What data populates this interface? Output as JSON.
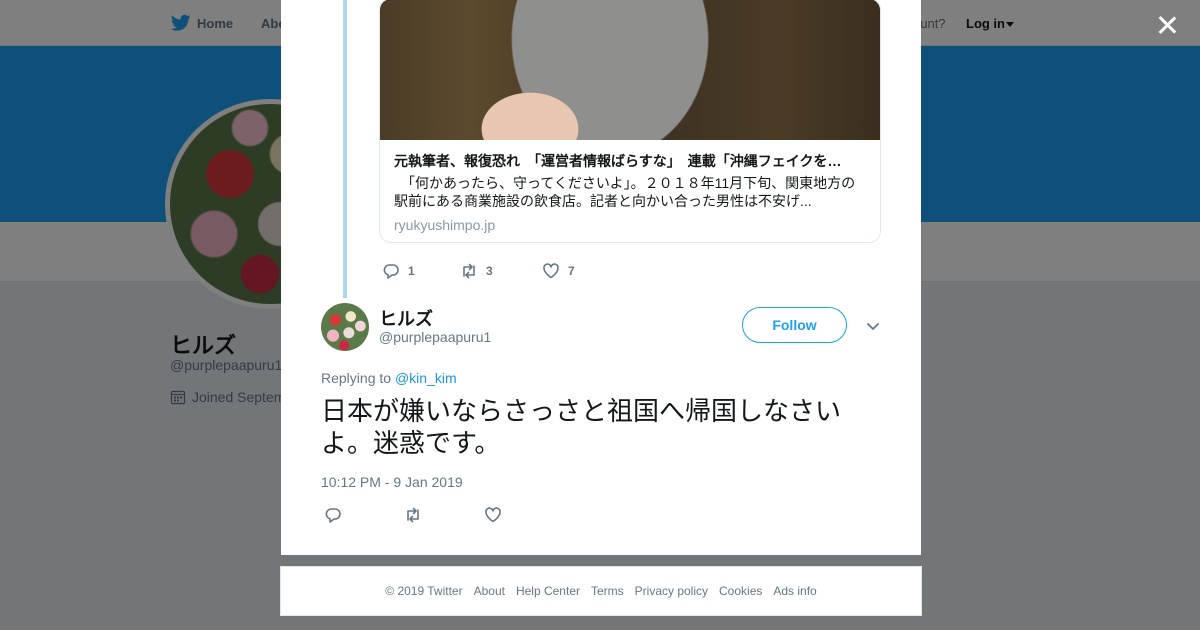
{
  "topbar": {
    "home_label": "Home",
    "about_label": "Abo",
    "account_prompt": "ccount?",
    "login_label": "Log in"
  },
  "profile": {
    "name": "ヒルズ",
    "handle": "@purplepaapuru1",
    "joined": "Joined Septem"
  },
  "link_card": {
    "title": "元執筆者、報復恐れ　「運営者情報ばらすな」　連載「沖縄フェイクを…",
    "description": "　「何かあったら、守ってくださいよ」。２０１８年11月下旬、関東地方の駅前にある商業施設の飲食店。記者と向かい合った男性は不安げ...",
    "domain": "ryukyushimpo.jp"
  },
  "parent_actions": {
    "replies": "1",
    "retweets": "3",
    "likes": "7"
  },
  "tweet": {
    "author_name": "ヒルズ",
    "author_handle": "@purplepaapuru1",
    "follow_label": "Follow",
    "replying_prefix": "Replying to ",
    "replying_to": "@kin_kim",
    "text": "日本が嫌いならさっさと祖国へ帰国しなさいよ。迷惑です。",
    "timestamp": "10:12 PM - 9 Jan 2019"
  },
  "footer": {
    "copyright": "© 2019 Twitter",
    "links": [
      "About",
      "Help Center",
      "Terms",
      "Privacy policy",
      "Cookies",
      "Ads info"
    ]
  },
  "colors": {
    "brand": "#1da1f2",
    "thread_line": "#aad8f5",
    "link": "#1b95e0",
    "muted": "#657786"
  }
}
